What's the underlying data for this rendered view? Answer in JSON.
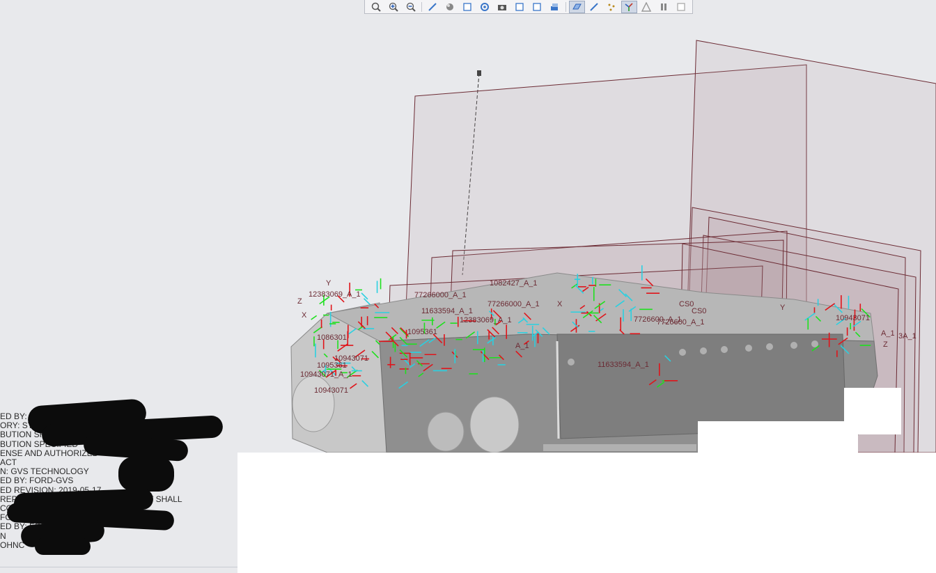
{
  "toolbar": {
    "buttons": [
      {
        "icon": "zoom-fit-icon"
      },
      {
        "icon": "zoom-in-icon"
      },
      {
        "icon": "zoom-out-icon"
      },
      {
        "icon": "repaint-icon"
      },
      {
        "icon": "shading-icon"
      },
      {
        "icon": "saved-views-icon"
      },
      {
        "icon": "view-manager-icon"
      },
      {
        "icon": "camera-icon"
      },
      {
        "icon": "datum-display-icon"
      },
      {
        "icon": "annotation-display-icon"
      },
      {
        "icon": "layers-icon"
      },
      {
        "icon": "plane-display-icon",
        "active": true
      },
      {
        "icon": "axis-display-icon"
      },
      {
        "icon": "point-display-icon"
      },
      {
        "icon": "csys-display-icon",
        "active": true
      },
      {
        "icon": "warning-icon"
      },
      {
        "icon": "pause-icon"
      },
      {
        "icon": "regenerate-icon"
      }
    ]
  },
  "model": {
    "labels": [
      "12383069_A_1",
      "77266000_A_1",
      "1095361",
      "10943071",
      "11633594_A_1",
      "CS0",
      "Y",
      "Z",
      "X",
      "A_1",
      "7726600_A_1",
      "1082427_A_1",
      "10943071_A_1",
      "1086301",
      "10943071",
      "3A_1"
    ]
  },
  "drawing_notes": {
    "lines": [
      "ED BY: FORD-GVS",
      "ORY: STUTTG    TECHNICAL",
      "BUTION SHALL                    COMPANY",
      "BUTION SPECIFIED",
      "ENSE AND AUTHORIZED",
      "ACT",
      "N: GVS TECHNOLOGY",
      "ED BY: FORD-GVS",
      "ED REVISION: 2019-05-17",
      "REPRODUCTION OF THIS DOCUMENT SHALL",
      "                               COMP",
      "                             FORD-GVS",
      "ED BY: FORD-GVS",
      "N",
      "OHNC"
    ]
  },
  "colors": {
    "background": "#e8e9ec",
    "plane_border": "#6b2a33",
    "plane_fill": "#b49aa0",
    "csys_red": "#e0141a",
    "csys_green": "#1ee01e",
    "csys_cyan": "#2ad0e0",
    "model_gray": "#8c8c8c"
  }
}
